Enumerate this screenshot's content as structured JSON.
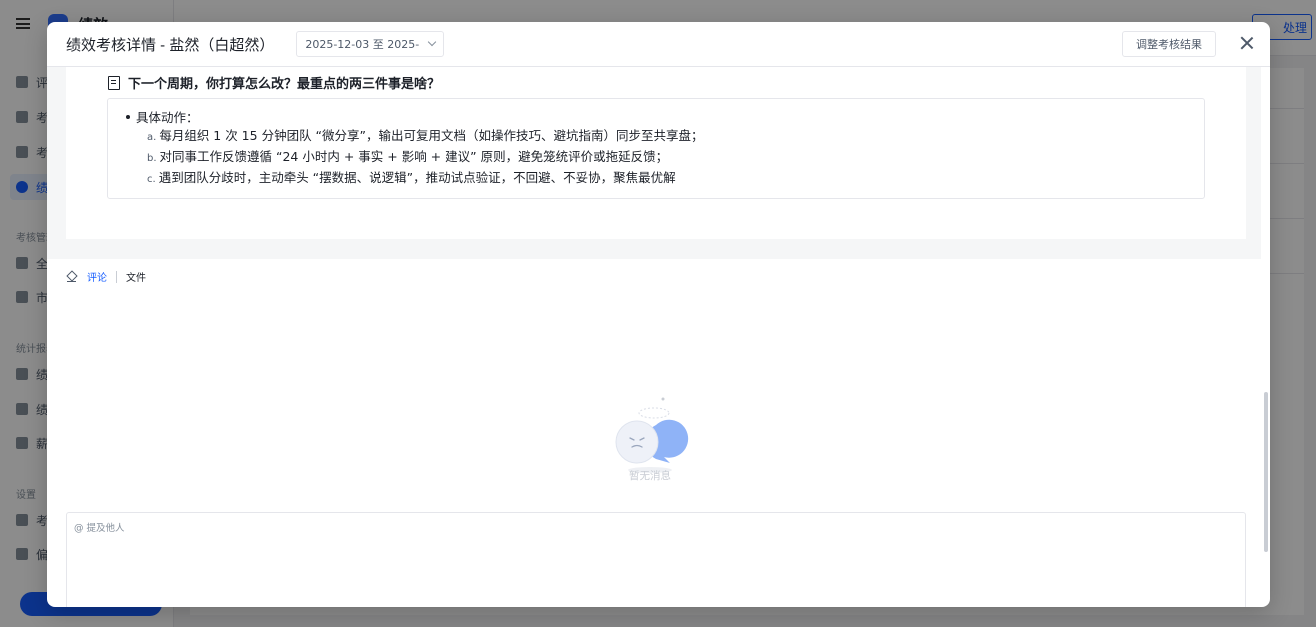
{
  "background": {
    "logo_text": "绩效",
    "sidebar_items": [
      {
        "label": "评"
      },
      {
        "label": "考"
      },
      {
        "label": "考"
      },
      {
        "label": "绩"
      }
    ],
    "group_manage": "考核管理",
    "manage_items": [
      {
        "label": "全"
      },
      {
        "label": "市"
      }
    ],
    "group_stats": "统计报表",
    "stats_items": [
      {
        "label": "绩"
      },
      {
        "label": "绩"
      },
      {
        "label": "薪"
      }
    ],
    "group_settings": "设置",
    "settings_items": [
      {
        "label": "考"
      },
      {
        "label": "偏"
      }
    ],
    "handle_btn": "处理"
  },
  "modal": {
    "title": "绩效考核详情 - 盐然（白超然）",
    "date_range": "2025-12-03 至 2025-",
    "adjust_btn": "调整考核结果",
    "question": "下一个周期，你打算怎么改？最重点的两三件事是啥？",
    "answer": {
      "heading": "具体动作：",
      "items": [
        {
          "marker": "a.",
          "text": "每月组织 1 次 15 分钟团队 “微分享”，输出可复用文档（如操作技巧、避坑指南）同步至共享盘；"
        },
        {
          "marker": "b.",
          "text": "对同事工作反馈遵循 “24 小时内 + 事实 + 影响 + 建议” 原则，避免笼统评价或拖延反馈；"
        },
        {
          "marker": "c.",
          "text": "遇到团队分歧时，主动牵头 “摆数据、说逻辑”，推动试点验证，不回避、不妥协，聚焦最优解"
        }
      ]
    },
    "tabs": {
      "comments": "评论",
      "files": "文件"
    },
    "empty_text": "暂无消息",
    "comment_placeholder": "@ 提及他人"
  },
  "colors": {
    "accent": "#165dff",
    "text": "#1d2129",
    "muted": "#86909c",
    "border": "#e5e6eb"
  }
}
